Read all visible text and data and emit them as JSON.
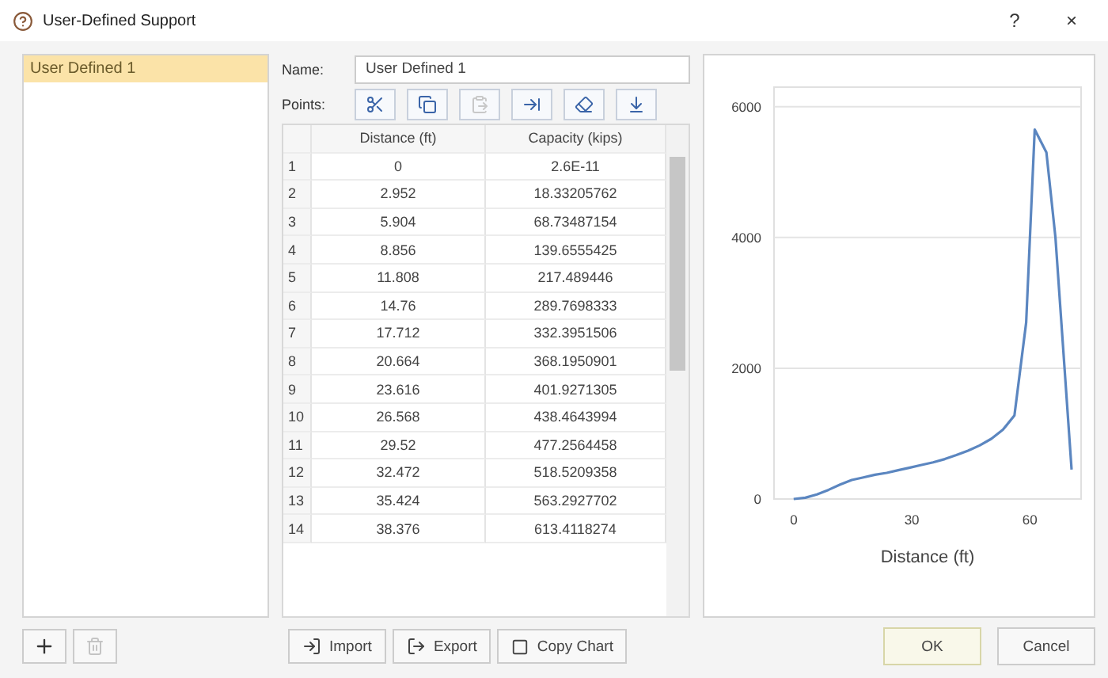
{
  "window": {
    "title": "User-Defined Support",
    "help": "?",
    "close": "×"
  },
  "supports": [
    {
      "label": "User Defined 1",
      "selected": true
    }
  ],
  "name_field": {
    "label": "Name:",
    "value": "User Defined 1"
  },
  "points": {
    "label": "Points:",
    "tools": [
      {
        "kind": "cut",
        "disabled": false
      },
      {
        "kind": "copy",
        "disabled": false
      },
      {
        "kind": "paste",
        "disabled": true
      },
      {
        "kind": "insert",
        "disabled": false
      },
      {
        "kind": "delete",
        "disabled": false
      },
      {
        "kind": "fill",
        "disabled": false
      }
    ]
  },
  "table": {
    "columns": [
      "",
      "Distance (ft)",
      "Capacity (kips)"
    ],
    "rows": [
      [
        "1",
        "0",
        "2.6E-11"
      ],
      [
        "2",
        "2.952",
        "18.33205762"
      ],
      [
        "3",
        "5.904",
        "68.73487154"
      ],
      [
        "4",
        "8.856",
        "139.6555425"
      ],
      [
        "5",
        "11.808",
        "217.489446"
      ],
      [
        "6",
        "14.76",
        "289.7698333"
      ],
      [
        "7",
        "17.712",
        "332.3951506"
      ],
      [
        "8",
        "20.664",
        "368.1950901"
      ],
      [
        "9",
        "23.616",
        "401.9271305"
      ],
      [
        "10",
        "26.568",
        "438.4643994"
      ],
      [
        "11",
        "29.52",
        "477.2564458"
      ],
      [
        "12",
        "32.472",
        "518.5209358"
      ],
      [
        "13",
        "35.424",
        "563.2927702"
      ],
      [
        "14",
        "38.376",
        "613.4118274"
      ]
    ]
  },
  "actions": [
    {
      "kind": "import",
      "label": "Import"
    },
    {
      "kind": "export",
      "label": "Export"
    },
    {
      "kind": "copy",
      "label": "Copy Chart"
    }
  ],
  "list_actions": [
    {
      "kind": "add",
      "disabled": false
    },
    {
      "kind": "delete",
      "disabled": true
    }
  ],
  "dialog_buttons": [
    {
      "label": "OK",
      "default": true
    },
    {
      "label": "Cancel",
      "default": false
    }
  ],
  "chart": {
    "chart_data": {
      "type": "line",
      "grid": true,
      "xlabel": "Distance (ft)",
      "xlim": [
        -5,
        73
      ],
      "ylim": [
        0,
        6300
      ],
      "xticks": [
        0,
        30,
        60
      ],
      "yticks": [
        0,
        2000,
        4000,
        6000
      ],
      "x": [
        0,
        2.952,
        5.904,
        8.856,
        11.808,
        14.76,
        17.712,
        20.664,
        23.616,
        26.568,
        29.52,
        32.472,
        35.424,
        38.376,
        41.328,
        44.28,
        47.232,
        50.184,
        53.136,
        56.088,
        59.04,
        61.2,
        64.2,
        66.5,
        70.6
      ],
      "series": [
        {
          "color": "#5b86c0",
          "values": [
            0,
            20,
            70,
            140,
            220,
            290,
            330,
            370,
            400,
            440,
            480,
            520,
            560,
            610,
            670,
            740,
            820,
            920,
            1060,
            1280,
            2700,
            5650,
            5300,
            4000,
            450
          ]
        }
      ]
    }
  }
}
